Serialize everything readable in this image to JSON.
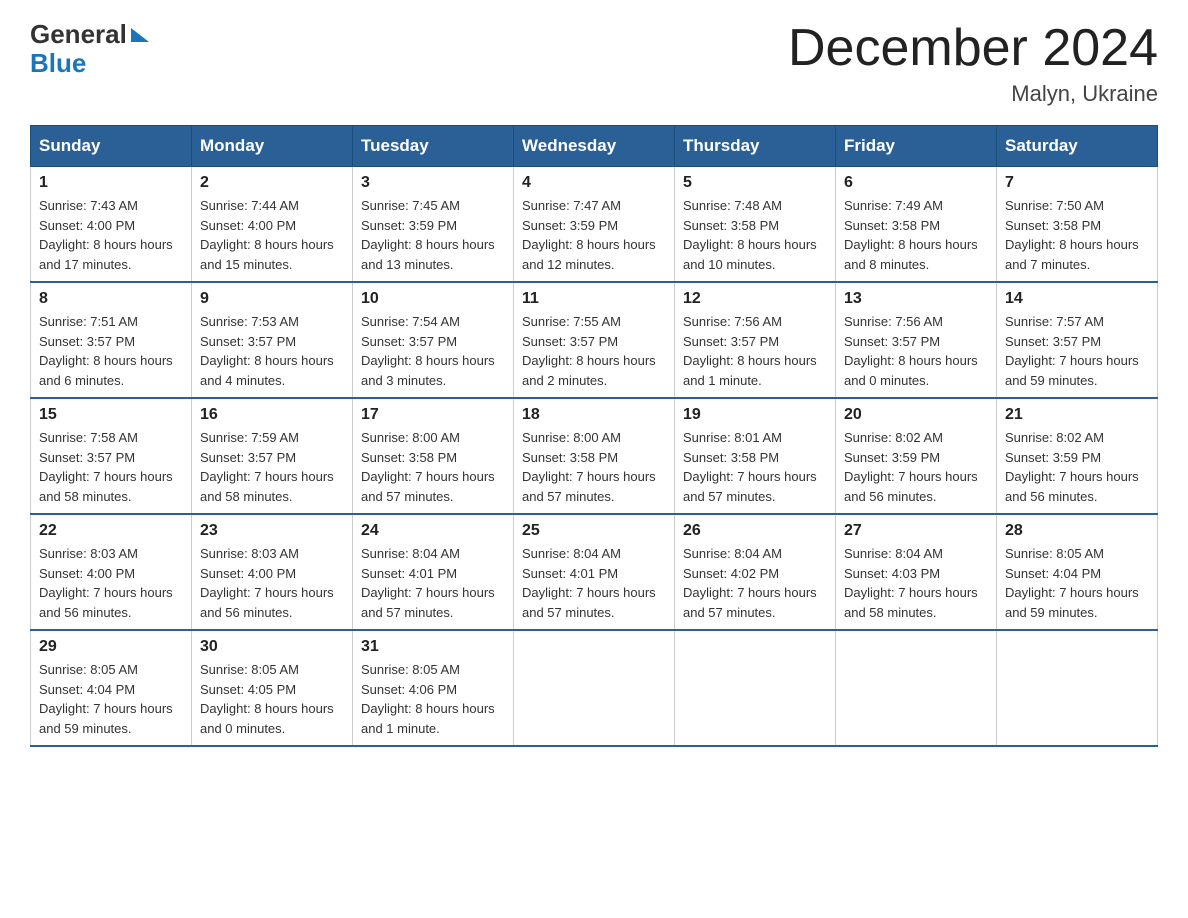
{
  "header": {
    "logo_line1": "General",
    "logo_line2": "Blue",
    "calendar_title": "December 2024",
    "calendar_subtitle": "Malyn, Ukraine"
  },
  "weekdays": [
    "Sunday",
    "Monday",
    "Tuesday",
    "Wednesday",
    "Thursday",
    "Friday",
    "Saturday"
  ],
  "weeks": [
    [
      {
        "day": "1",
        "sunrise": "7:43 AM",
        "sunset": "4:00 PM",
        "daylight": "8 hours and 17 minutes."
      },
      {
        "day": "2",
        "sunrise": "7:44 AM",
        "sunset": "4:00 PM",
        "daylight": "8 hours and 15 minutes."
      },
      {
        "day": "3",
        "sunrise": "7:45 AM",
        "sunset": "3:59 PM",
        "daylight": "8 hours and 13 minutes."
      },
      {
        "day": "4",
        "sunrise": "7:47 AM",
        "sunset": "3:59 PM",
        "daylight": "8 hours and 12 minutes."
      },
      {
        "day": "5",
        "sunrise": "7:48 AM",
        "sunset": "3:58 PM",
        "daylight": "8 hours and 10 minutes."
      },
      {
        "day": "6",
        "sunrise": "7:49 AM",
        "sunset": "3:58 PM",
        "daylight": "8 hours and 8 minutes."
      },
      {
        "day": "7",
        "sunrise": "7:50 AM",
        "sunset": "3:58 PM",
        "daylight": "8 hours and 7 minutes."
      }
    ],
    [
      {
        "day": "8",
        "sunrise": "7:51 AM",
        "sunset": "3:57 PM",
        "daylight": "8 hours and 6 minutes."
      },
      {
        "day": "9",
        "sunrise": "7:53 AM",
        "sunset": "3:57 PM",
        "daylight": "8 hours and 4 minutes."
      },
      {
        "day": "10",
        "sunrise": "7:54 AM",
        "sunset": "3:57 PM",
        "daylight": "8 hours and 3 minutes."
      },
      {
        "day": "11",
        "sunrise": "7:55 AM",
        "sunset": "3:57 PM",
        "daylight": "8 hours and 2 minutes."
      },
      {
        "day": "12",
        "sunrise": "7:56 AM",
        "sunset": "3:57 PM",
        "daylight": "8 hours and 1 minute."
      },
      {
        "day": "13",
        "sunrise": "7:56 AM",
        "sunset": "3:57 PM",
        "daylight": "8 hours and 0 minutes."
      },
      {
        "day": "14",
        "sunrise": "7:57 AM",
        "sunset": "3:57 PM",
        "daylight": "7 hours and 59 minutes."
      }
    ],
    [
      {
        "day": "15",
        "sunrise": "7:58 AM",
        "sunset": "3:57 PM",
        "daylight": "7 hours and 58 minutes."
      },
      {
        "day": "16",
        "sunrise": "7:59 AM",
        "sunset": "3:57 PM",
        "daylight": "7 hours and 58 minutes."
      },
      {
        "day": "17",
        "sunrise": "8:00 AM",
        "sunset": "3:58 PM",
        "daylight": "7 hours and 57 minutes."
      },
      {
        "day": "18",
        "sunrise": "8:00 AM",
        "sunset": "3:58 PM",
        "daylight": "7 hours and 57 minutes."
      },
      {
        "day": "19",
        "sunrise": "8:01 AM",
        "sunset": "3:58 PM",
        "daylight": "7 hours and 57 minutes."
      },
      {
        "day": "20",
        "sunrise": "8:02 AM",
        "sunset": "3:59 PM",
        "daylight": "7 hours and 56 minutes."
      },
      {
        "day": "21",
        "sunrise": "8:02 AM",
        "sunset": "3:59 PM",
        "daylight": "7 hours and 56 minutes."
      }
    ],
    [
      {
        "day": "22",
        "sunrise": "8:03 AM",
        "sunset": "4:00 PM",
        "daylight": "7 hours and 56 minutes."
      },
      {
        "day": "23",
        "sunrise": "8:03 AM",
        "sunset": "4:00 PM",
        "daylight": "7 hours and 56 minutes."
      },
      {
        "day": "24",
        "sunrise": "8:04 AM",
        "sunset": "4:01 PM",
        "daylight": "7 hours and 57 minutes."
      },
      {
        "day": "25",
        "sunrise": "8:04 AM",
        "sunset": "4:01 PM",
        "daylight": "7 hours and 57 minutes."
      },
      {
        "day": "26",
        "sunrise": "8:04 AM",
        "sunset": "4:02 PM",
        "daylight": "7 hours and 57 minutes."
      },
      {
        "day": "27",
        "sunrise": "8:04 AM",
        "sunset": "4:03 PM",
        "daylight": "7 hours and 58 minutes."
      },
      {
        "day": "28",
        "sunrise": "8:05 AM",
        "sunset": "4:04 PM",
        "daylight": "7 hours and 59 minutes."
      }
    ],
    [
      {
        "day": "29",
        "sunrise": "8:05 AM",
        "sunset": "4:04 PM",
        "daylight": "7 hours and 59 minutes."
      },
      {
        "day": "30",
        "sunrise": "8:05 AM",
        "sunset": "4:05 PM",
        "daylight": "8 hours and 0 minutes."
      },
      {
        "day": "31",
        "sunrise": "8:05 AM",
        "sunset": "4:06 PM",
        "daylight": "8 hours and 1 minute."
      },
      null,
      null,
      null,
      null
    ]
  ]
}
